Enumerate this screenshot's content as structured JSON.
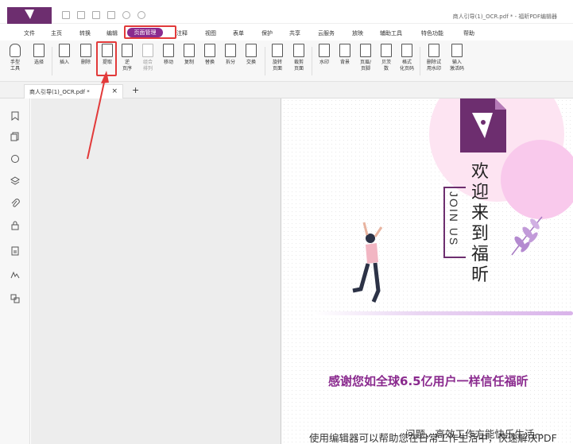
{
  "window": {
    "title": "商人引导(1)_OCR.pdf * - 福昕PDF编辑器"
  },
  "menu": {
    "items": [
      "文件",
      "主页",
      "转换",
      "编辑",
      "页面管理",
      "注释",
      "视图",
      "表单",
      "保护",
      "共享",
      "云服务",
      "放映",
      "辅助工具",
      "特色功能",
      "帮助"
    ],
    "active": "页面管理"
  },
  "ribbon": {
    "buttons": [
      {
        "label": "手型\n工具",
        "icon": "hand-icon"
      },
      {
        "label": "选择",
        "icon": "select-icon"
      },
      {
        "label": "插入",
        "icon": "insert-page-icon"
      },
      {
        "label": "删除",
        "icon": "delete-page-icon"
      },
      {
        "label": "提取",
        "icon": "extract-page-icon"
      },
      {
        "label": "逆\n页序",
        "icon": "reverse-icon"
      },
      {
        "label": "组合\n排列",
        "icon": "arrange-icon"
      },
      {
        "label": "移动",
        "icon": "move-icon"
      },
      {
        "label": "复制",
        "icon": "copy-icon"
      },
      {
        "label": "替换",
        "icon": "replace-icon"
      },
      {
        "label": "拆分",
        "icon": "split-icon"
      },
      {
        "label": "交换",
        "icon": "swap-icon"
      },
      {
        "label": "旋转\n页面",
        "icon": "rotate-icon"
      },
      {
        "label": "裁剪\n页面",
        "icon": "crop-icon"
      },
      {
        "label": "水印",
        "icon": "watermark-icon"
      },
      {
        "label": "背景",
        "icon": "background-icon"
      },
      {
        "label": "页眉/\n页脚",
        "icon": "header-footer-icon"
      },
      {
        "label": "贝茨\n数",
        "icon": "bates-icon"
      },
      {
        "label": "格式\n化页码",
        "icon": "page-number-icon"
      },
      {
        "label": "删除试\n用水印",
        "icon": "remove-watermark-icon"
      },
      {
        "label": "输入\n激活码",
        "icon": "activation-icon"
      }
    ]
  },
  "tabs": {
    "document": "商人引导(1)_OCR.pdf *",
    "close": "×",
    "add": "+"
  },
  "sidebar": {
    "icons": [
      "bookmark-icon",
      "pages-icon",
      "comment-icon",
      "layers-icon",
      "attachment-icon",
      "security-icon",
      "document-icon",
      "signature-icon",
      "compare-icon"
    ]
  },
  "page": {
    "welcome": "欢迎来到福昕",
    "join": "JOIN US",
    "thanks": "感谢您如全球6.5亿用户一样信任福昕",
    "desc_line1": "使用编辑器可以帮助您在日常工作生活中，快速解决PDF",
    "desc_line2": "问题，高效工作方能快乐生活~"
  },
  "colors": {
    "brand": "#6d2e6f",
    "accent": "#8a2a8e",
    "highlight": "#e23a3a"
  }
}
